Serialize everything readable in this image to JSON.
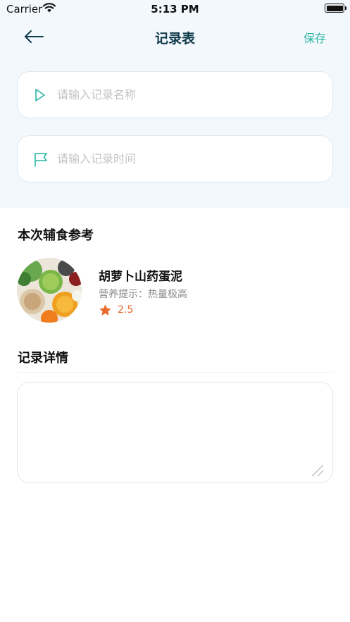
{
  "status_bar": {
    "carrier": "Carrier",
    "time": "5:13 PM"
  },
  "nav": {
    "title": "记录表",
    "save_label": "保存"
  },
  "form": {
    "name_placeholder": "请输入记录名称",
    "time_placeholder": "请输入记录时间"
  },
  "reference": {
    "section_title": "本次辅食参考",
    "recipe_name": "胡萝卜山药蛋泥",
    "hint": "营养提示：热量极高",
    "rating": "2.5"
  },
  "details": {
    "section_title": "记录详情",
    "value": ""
  },
  "colors": {
    "accent": "#2ab5a2",
    "rating": "#e8692c",
    "title": "#0f3a4a",
    "header_bg": "#f3f8fd"
  }
}
